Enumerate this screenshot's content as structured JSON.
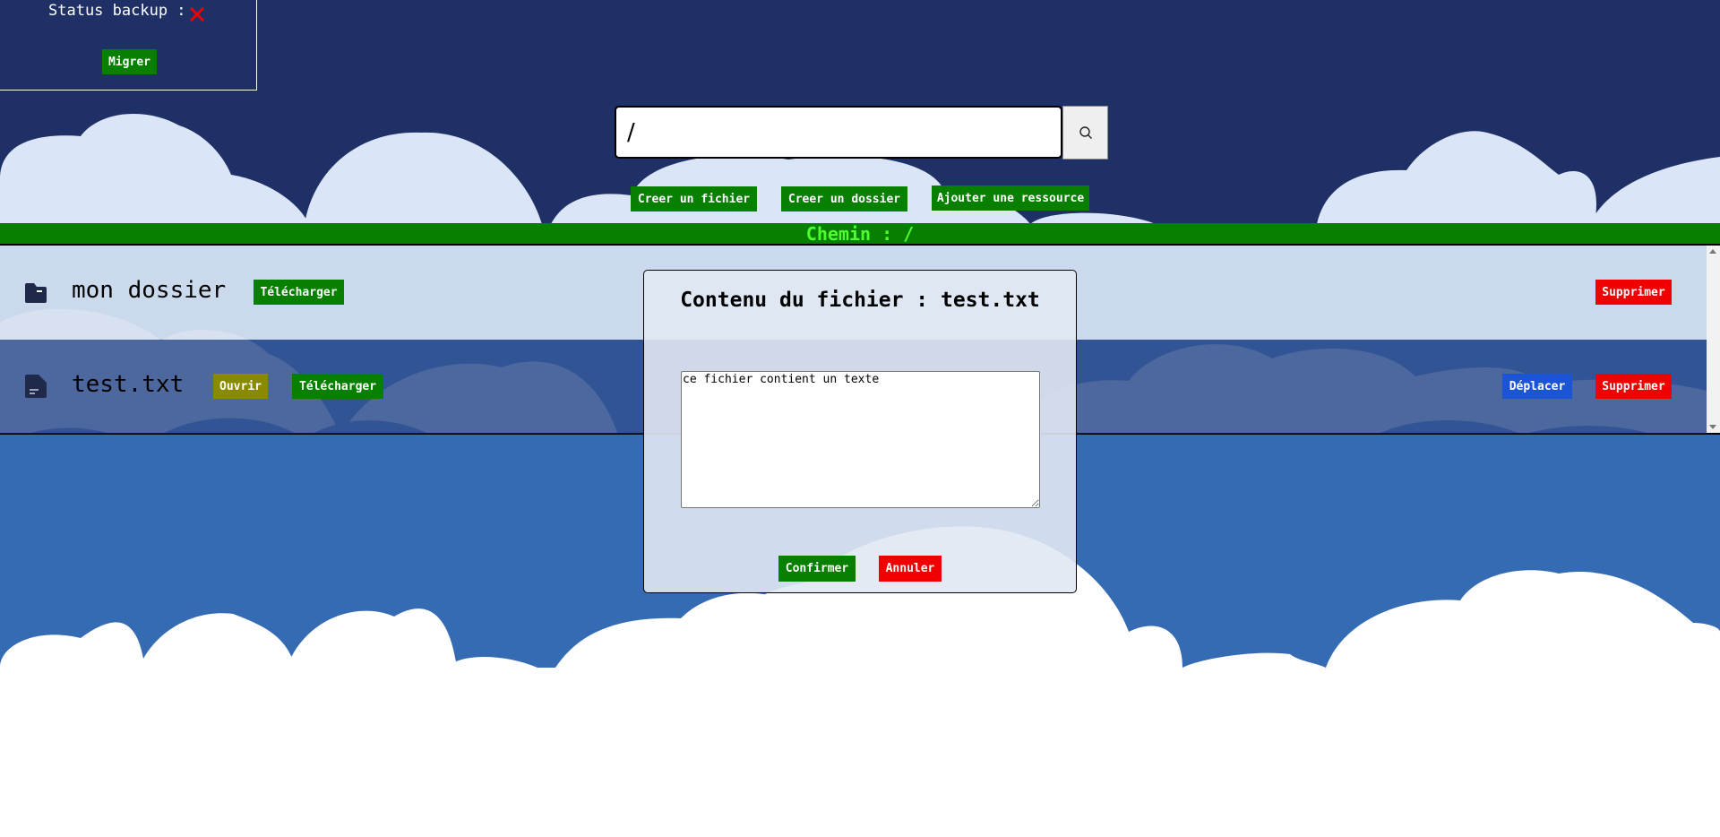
{
  "status": {
    "label": "Status backup :",
    "state_icon": "cross-icon",
    "state_color": "#f00000",
    "migrate_label": "Migrer"
  },
  "search": {
    "value": "/",
    "icon": "search-icon"
  },
  "actions": {
    "create_file": "Creer un fichier",
    "create_folder": "Creer un dossier",
    "add_resource": "Ajouter une ressource"
  },
  "path": {
    "label": "Chemin : /"
  },
  "files": [
    {
      "name": "mon dossier",
      "type": "folder",
      "icon": "folder-icon",
      "download": "Télécharger",
      "delete": "Supprimer"
    },
    {
      "name": "test.txt",
      "type": "file",
      "icon": "file-icon",
      "open": "Ouvrir",
      "download": "Télécharger",
      "move": "Déplacer",
      "delete": "Supprimer"
    }
  ],
  "modal": {
    "title": "Contenu du fichier : test.txt",
    "content": "ce fichier contient un texte",
    "confirm": "Confirmer",
    "cancel": "Annuler"
  },
  "colors": {
    "background_dark": "#1f3066",
    "cloud_light": "#dbe5f8",
    "background_mid": "#356bb2",
    "button_green": "#078000",
    "button_red": "#f00000",
    "button_olive": "#8a8a00",
    "button_blue": "#1c54d6",
    "path_text": "#4dff2e"
  }
}
